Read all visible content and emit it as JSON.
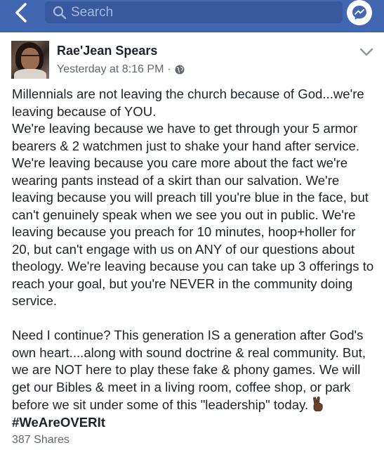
{
  "topbar": {
    "back_icon": "chevron-left-icon",
    "search_icon": "search-icon",
    "search_placeholder": "Search",
    "messenger_icon": "messenger-icon",
    "background_color": "#4267b2"
  },
  "post": {
    "author": "Rae'Jean Spears",
    "timestamp": "Yesterday at 8:16 PM",
    "separator": "·",
    "privacy_icon": "globe-icon",
    "menu_icon": "chevron-down-icon",
    "paragraphs": [
      "Millennials are not leaving the church because of God...we're leaving because of YOU.\nWe're leaving because we have to get through your 5 armor bearers & 2 watchmen just to shake your hand after service. We're leaving because you care more about the fact we're wearing pants instead of a skirt than our salvation. We're leaving because you will preach till you're blue in the face, but can't genuinely speak when we see you out in public. We're leaving because you preach for 10 minutes, hoop+holler for 20, but can't engage with us on ANY of our questions about theology. We're leaving because you can take up 3 offerings to reach your goal, but you're NEVER in the community doing service.",
      "Need I continue? This generation IS a generation after God's own heart....along with sound doctrine & real community. But, we are NOT here to play these fake & phony games. We will get our Bibles & meet in a living room, coffee shop, or park before we sit under some of this \"leadership\" today."
    ],
    "emoji": "victory-hand-icon",
    "hashtag": "#WeAreOVERIt",
    "shares": "387 Shares"
  }
}
